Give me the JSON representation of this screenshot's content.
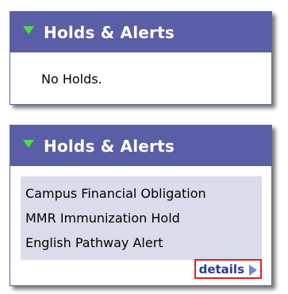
{
  "panels": [
    {
      "title": "Holds & Alerts",
      "message": "No Holds."
    },
    {
      "title": "Holds & Alerts",
      "items": [
        "Campus Financial Obligation",
        "MMR Immunization Hold",
        "English Pathway Alert"
      ],
      "details_label": "details"
    }
  ],
  "colors": {
    "header_bg": "#5a5ea6",
    "toggle_icon": "#4ddc4d",
    "list_bg": "#dadceb",
    "details_text": "#2a3a9a",
    "details_border": "#e02020",
    "arrow": "#6f86dd"
  },
  "icons": {
    "toggle": "triangle-down-icon",
    "details_arrow": "arrow-right-icon"
  }
}
